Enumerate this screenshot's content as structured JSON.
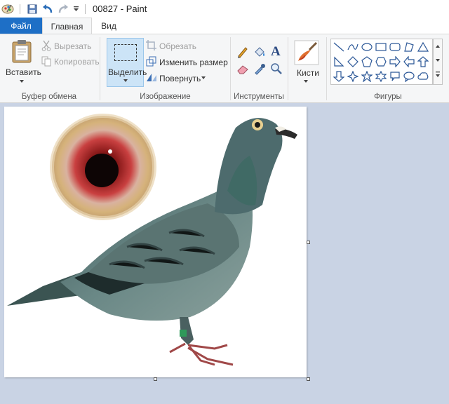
{
  "window": {
    "title": "00827 - Paint"
  },
  "tabs": {
    "file": "Файл",
    "home": "Главная",
    "view": "Вид"
  },
  "clipboard": {
    "paste": "Вставить",
    "cut": "Вырезать",
    "copy": "Копировать",
    "group": "Буфер обмена"
  },
  "image": {
    "select": "Выделить",
    "crop": "Обрезать",
    "resize": "Изменить размер",
    "rotate": "Повернуть",
    "group": "Изображение"
  },
  "tools": {
    "group": "Инструменты"
  },
  "brushes": {
    "label": "Кисти"
  },
  "shapes": {
    "group": "Фигуры"
  },
  "colors": {
    "accent": "#1e6fc6",
    "ribbon": "#f5f6f7",
    "workspace": "#c9d3e4",
    "selected": "#cce4f7"
  }
}
